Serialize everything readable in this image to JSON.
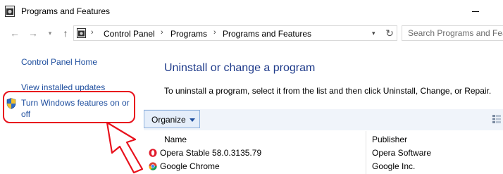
{
  "window": {
    "title": "Programs and Features"
  },
  "address": {
    "crumbs": [
      "Control Panel",
      "Programs",
      "Programs and Features"
    ],
    "search_placeholder": "Search Programs and Featu"
  },
  "left_pane": {
    "home": "Control Panel Home",
    "updates": "View installed updates",
    "features": "Turn Windows features on or off"
  },
  "main": {
    "title": "Uninstall or change a program",
    "description": "To uninstall a program, select it from the list and then click Uninstall, Change, or Repair.",
    "organize_label": "Organize",
    "columns": [
      "Name",
      "Publisher"
    ],
    "programs": [
      {
        "name": "Opera Stable 58.0.3135.79",
        "publisher": "Opera Software",
        "icon": "opera-icon"
      },
      {
        "name": "Google Chrome",
        "publisher": "Google Inc.",
        "icon": "chrome-icon"
      }
    ]
  },
  "colors": {
    "link": "#1e4e9e",
    "highlight": "#e8121d",
    "title": "#1e3a8a"
  }
}
